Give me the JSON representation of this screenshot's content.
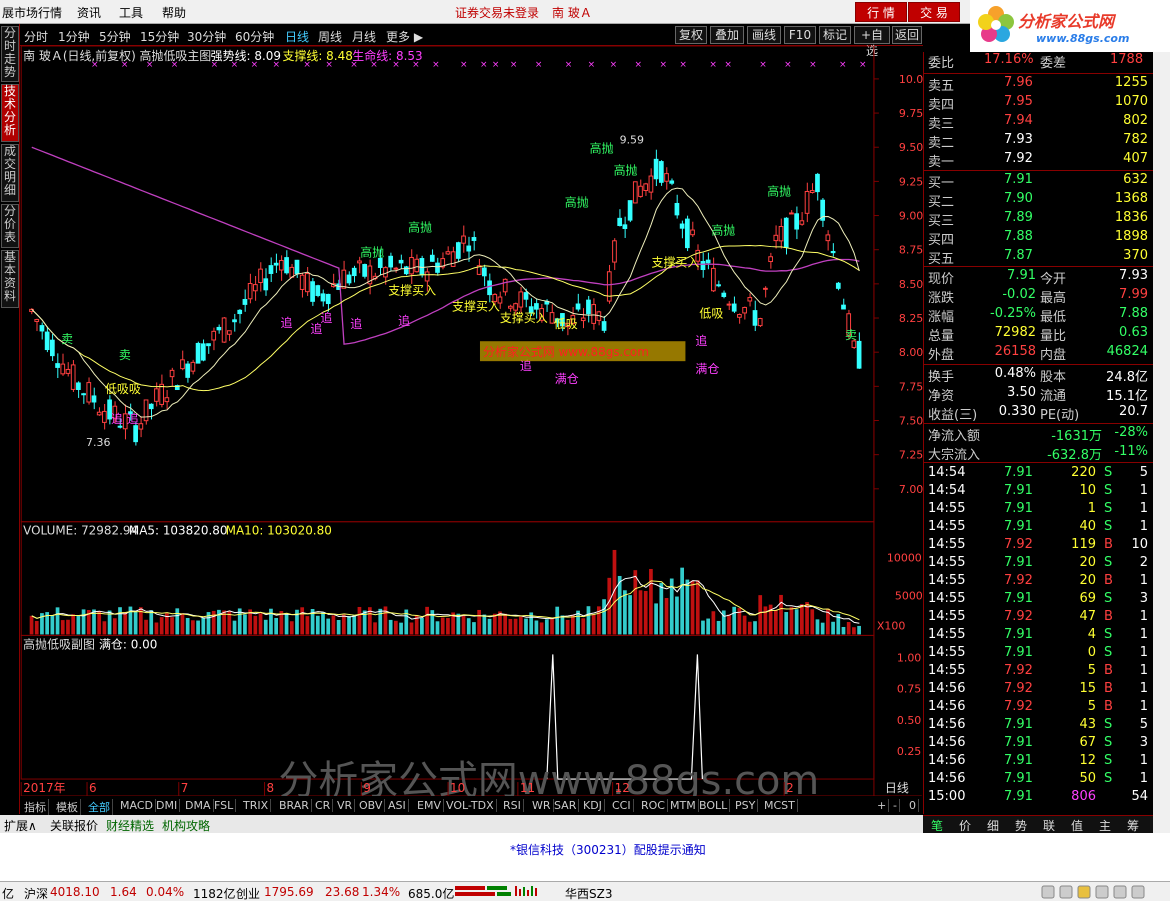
{
  "menu": {
    "items": [
      "展市场行情",
      "资讯",
      "工具",
      "帮助"
    ],
    "status": "证券交易未登录",
    "stock": "南 玻Ａ",
    "btn_quote": "行 情",
    "btn_trade": "交 易"
  },
  "logo": {
    "title": "分析家公式网",
    "url": "www.88gs.com"
  },
  "left_tabs": [
    "分时走势",
    "技术分析",
    "成交明细",
    "分价表",
    "基本资料"
  ],
  "periods": [
    "分时",
    "1分钟",
    "5分钟",
    "15分钟",
    "30分钟",
    "60分钟",
    "日线",
    "周线",
    "月线",
    "更多 ▶"
  ],
  "active_period": "日线",
  "toolbar": [
    "复权",
    "叠加",
    "画线",
    "F10",
    "标记",
    "+自选",
    "返回"
  ],
  "main_chart": {
    "title": "南 玻Ａ(日线,前复权) 高抛低吸主图",
    "strong_label": "强势线: 8.09",
    "support_label": "支撑线: 8.48",
    "life_label": "生命线: 8.53",
    "high_mark": "9.59",
    "low_mark": "7.36",
    "y_ticks": [
      "10.00",
      "9.75",
      "9.50",
      "9.25",
      "9.00",
      "8.75",
      "8.50",
      "8.25",
      "8.00",
      "7.75",
      "7.50",
      "7.25",
      "7.00"
    ],
    "watermark_small": "分析家公式网 www.88gs.com"
  },
  "chart_data": {
    "type": "candlestick",
    "y_range": [
      7.0,
      10.0
    ],
    "high": 9.59,
    "low": 7.36,
    "last": 7.91
  },
  "volume_chart": {
    "label": "VOLUME: 72982.94",
    "ma5": "MA5: 103820.80",
    "ma10": "MA10: 103020.80",
    "y_ticks": [
      "10000",
      "5000"
    ],
    "unit": "X100"
  },
  "sub_chart": {
    "title": "高抛低吸副图",
    "value": "满仓: 0.00",
    "y_ticks": [
      "1.00",
      "0.75",
      "0.50",
      "0.25"
    ]
  },
  "x_axis": {
    "labels": [
      "2017年",
      "6",
      "7",
      "8",
      "9",
      "10",
      "11",
      "12",
      "2"
    ],
    "period_label": "日线"
  },
  "big_watermark": "分析家公式网www.88gs.com",
  "signals": {
    "sell": "卖",
    "high_sell": "高抛",
    "low_buy": "低吸",
    "chase": "追",
    "support_buy": "支撑买入",
    "full": "满仓",
    "low_chase": "低吸吸",
    "chase_chase": "追 追"
  },
  "quote": {
    "entrust_ratio": {
      "label": "委比",
      "value": "17.16%",
      "label2": "委差",
      "value2": "1788"
    },
    "asks": [
      {
        "label": "卖五",
        "price": "7.96",
        "vol": "1255"
      },
      {
        "label": "卖四",
        "price": "7.95",
        "vol": "1070"
      },
      {
        "label": "卖三",
        "price": "7.94",
        "vol": "802"
      },
      {
        "label": "卖二",
        "price": "7.93",
        "vol": "782"
      },
      {
        "label": "卖一",
        "price": "7.92",
        "vol": "407"
      }
    ],
    "bids": [
      {
        "label": "买一",
        "price": "7.91",
        "vol": "632"
      },
      {
        "label": "买二",
        "price": "7.90",
        "vol": "1368"
      },
      {
        "label": "买三",
        "price": "7.89",
        "vol": "1836"
      },
      {
        "label": "买四",
        "price": "7.88",
        "vol": "1898"
      },
      {
        "label": "买五",
        "price": "7.87",
        "vol": "370"
      }
    ],
    "stats": [
      {
        "l1": "现价",
        "v1": "7.91",
        "l2": "今开",
        "v2": "7.93"
      },
      {
        "l1": "涨跌",
        "v1": "-0.02",
        "l2": "最高",
        "v2": "7.99"
      },
      {
        "l1": "涨幅",
        "v1": "-0.25%",
        "l2": "最低",
        "v2": "7.88"
      },
      {
        "l1": "总量",
        "v1": "72982",
        "l2": "量比",
        "v2": "0.63"
      },
      {
        "l1": "外盘",
        "v1": "26158",
        "l2": "内盘",
        "v2": "46824"
      }
    ],
    "stats2": [
      {
        "l1": "换手",
        "v1": "0.48%",
        "l2": "股本",
        "v2": "24.8亿"
      },
      {
        "l1": "净资",
        "v1": "3.50",
        "l2": "流通",
        "v2": "15.1亿"
      },
      {
        "l1": "收益(三)",
        "v1": "0.330",
        "l2": "PE(动)",
        "v2": "20.7"
      }
    ],
    "flows": [
      {
        "label": "净流入额",
        "value": "-1631万",
        "pct": "-28%"
      },
      {
        "label": "大宗流入",
        "value": "-632.8万",
        "pct": "-11%"
      }
    ]
  },
  "ticks": [
    {
      "t": "14:54",
      "p": "7.91",
      "v": "220",
      "s": "S",
      "n": "5"
    },
    {
      "t": "14:54",
      "p": "7.91",
      "v": "10",
      "s": "S",
      "n": "1"
    },
    {
      "t": "14:55",
      "p": "7.91",
      "v": "1",
      "s": "S",
      "n": "1"
    },
    {
      "t": "14:55",
      "p": "7.91",
      "v": "40",
      "s": "S",
      "n": "1"
    },
    {
      "t": "14:55",
      "p": "7.92",
      "v": "119",
      "s": "B",
      "n": "10"
    },
    {
      "t": "14:55",
      "p": "7.91",
      "v": "20",
      "s": "S",
      "n": "2"
    },
    {
      "t": "14:55",
      "p": "7.92",
      "v": "20",
      "s": "B",
      "n": "1"
    },
    {
      "t": "14:55",
      "p": "7.91",
      "v": "69",
      "s": "S",
      "n": "3"
    },
    {
      "t": "14:55",
      "p": "7.92",
      "v": "47",
      "s": "B",
      "n": "1"
    },
    {
      "t": "14:55",
      "p": "7.91",
      "v": "4",
      "s": "S",
      "n": "1"
    },
    {
      "t": "14:55",
      "p": "7.91",
      "v": "0",
      "s": "S",
      "n": "1"
    },
    {
      "t": "14:55",
      "p": "7.92",
      "v": "5",
      "s": "B",
      "n": "1"
    },
    {
      "t": "14:56",
      "p": "7.92",
      "v": "15",
      "s": "B",
      "n": "1"
    },
    {
      "t": "14:56",
      "p": "7.92",
      "v": "5",
      "s": "B",
      "n": "1"
    },
    {
      "t": "14:56",
      "p": "7.91",
      "v": "43",
      "s": "S",
      "n": "5"
    },
    {
      "t": "14:56",
      "p": "7.91",
      "v": "67",
      "s": "S",
      "n": "3"
    },
    {
      "t": "14:56",
      "p": "7.91",
      "v": "12",
      "s": "S",
      "n": "1"
    },
    {
      "t": "14:56",
      "p": "7.91",
      "v": "50",
      "s": "S",
      "n": "1"
    },
    {
      "t": "15:00",
      "p": "7.91",
      "v": "806",
      "s": "",
      "n": "54"
    }
  ],
  "indicator_tabs": [
    "指标",
    "模板",
    "全部",
    "MACD",
    "DMI",
    "DMA",
    "FSL",
    "TRIX",
    "BRAR",
    "CR",
    "VR",
    "OBV",
    "ASI",
    "EMV",
    "VOL-TDX",
    "RSI",
    "WR",
    "SAR",
    "KDJ",
    "CCI",
    "ROC",
    "MTM",
    "BOLL",
    "PSY",
    "MCST"
  ],
  "zoom_buttons": [
    "+",
    "-",
    "0"
  ],
  "ext_tabs": [
    "扩展∧",
    "关联报价",
    "财经精选",
    "机构攻略"
  ],
  "right_tabs": [
    "笔",
    "价",
    "细",
    "势",
    "联",
    "值",
    "主",
    "筹"
  ],
  "notice": "*银信科技（300231）配股提示通知",
  "statusbar": {
    "pre": "亿",
    "sh_label": "沪深",
    "sh_val": "4018.10",
    "sh_chg": "1.64",
    "sh_pct": "0.04%",
    "sh_amt": "1182亿",
    "cy_label": "创业",
    "cy_val": "1795.69",
    "cy_chg": "23.68",
    "cy_pct": "1.34%",
    "cy_amt": "685.0亿",
    "server": "华西SZ3"
  },
  "colors": {
    "up": "#ff4040",
    "down": "#33ffff",
    "ma_yellow": "#ffff66",
    "ma_purple": "#d040d0",
    "border": "#800000"
  }
}
